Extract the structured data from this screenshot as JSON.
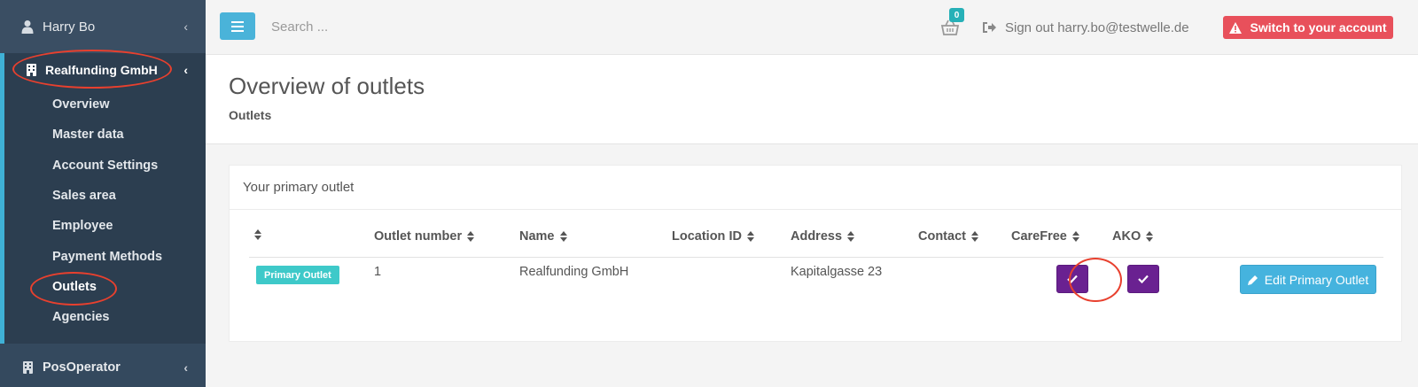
{
  "sidebar": {
    "user_name": "Harry Bo",
    "company_name": "Realfunding GmbH",
    "items": [
      {
        "label": "Overview"
      },
      {
        "label": "Master data"
      },
      {
        "label": "Account Settings"
      },
      {
        "label": "Sales area"
      },
      {
        "label": "Employee"
      },
      {
        "label": "Payment Methods"
      },
      {
        "label": "Outlets"
      },
      {
        "label": "Agencies"
      }
    ],
    "active_item": "Outlets",
    "pos_operator": "PosOperator"
  },
  "topbar": {
    "search_placeholder": "Search ...",
    "cart_count": "0",
    "signout_label": "Sign out harry.bo@testwelle.de",
    "switch_label": "Switch to your account"
  },
  "page": {
    "title": "Overview of outlets",
    "breadcrumb": "Outlets"
  },
  "panel": {
    "heading": "Your primary outlet",
    "columns": [
      "Outlet number",
      "Name",
      "Location ID",
      "Address",
      "Contact",
      "CareFree",
      "AKO"
    ],
    "row": {
      "badge": "Primary Outlet",
      "outlet_number": "1",
      "name": "Realfunding GmbH",
      "location_id": "",
      "address": "Kapitalgasse 23",
      "contact": "",
      "carefree": true,
      "ako": true
    },
    "edit_label": "Edit Primary Outlet"
  },
  "colors": {
    "sidebar_bg": "#34495e",
    "accent_blue": "#4ab3d9",
    "danger": "#e8505b",
    "badge_teal": "#3ec9c9",
    "check_purple": "#6a2191",
    "highlight_ring": "#e8402e"
  }
}
